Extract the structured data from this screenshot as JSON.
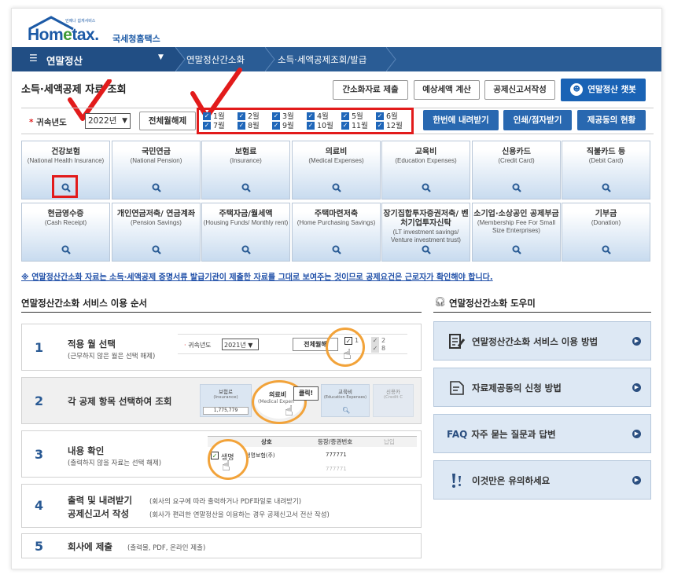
{
  "logo": {
    "tagline": "언제나 쉽게서비스",
    "brand_main": "Hom",
    "brand_e": "e",
    "brand_end": "tax.",
    "brand_kr": "국세청홈택스"
  },
  "nav": {
    "menu_label": "연말정산",
    "crumb1": "연말정산간소화",
    "crumb2": "소득·세액공제조회/발급"
  },
  "page": {
    "title": "소득·세액공제 자료 조회"
  },
  "top_buttons": [
    "간소화자료 제출",
    "예상세액 계산",
    "공제신고서작성",
    "연말정산 챗봇"
  ],
  "filter": {
    "label": "귀속년도",
    "year": "2022년",
    "deselect_all": "전체월해제",
    "months": [
      "1월",
      "2월",
      "3월",
      "4월",
      "5월",
      "6월",
      "7월",
      "8월",
      "9월",
      "10월",
      "11월",
      "12월"
    ],
    "actions": [
      "한번에 내려받기",
      "인쇄/점자받기",
      "제공동의 현황"
    ]
  },
  "tiles_row1": [
    {
      "ko": "건강보험",
      "en": "(National Health Insurance)"
    },
    {
      "ko": "국민연금",
      "en": "(National Pension)"
    },
    {
      "ko": "보험료",
      "en": "(Insurance)"
    },
    {
      "ko": "의료비",
      "en": "(Medical Expenses)"
    },
    {
      "ko": "교육비",
      "en": "(Education Expenses)"
    },
    {
      "ko": "신용카드",
      "en": "(Credit Card)"
    },
    {
      "ko": "직불카드 등",
      "en": "(Debit Card)"
    }
  ],
  "tiles_row2": [
    {
      "ko": "현금영수증",
      "en": "(Cash Receipt)"
    },
    {
      "ko": "개인연금저축/ 연금계좌",
      "en": "(Pension Savings)"
    },
    {
      "ko": "주택자금/월세액",
      "en": "(Housing Funds/ Monthly rent)"
    },
    {
      "ko": "주택마련저축",
      "en": "(Home Purchasing Savings)"
    },
    {
      "ko": "장기집합투자증권저축/ 벤처기업투자신탁",
      "en": "(LT investment savings/ Venture investment trust)"
    },
    {
      "ko": "소기업·소상공인 공제부금",
      "en": "(Membership Fee For Small Size Enterprises)"
    },
    {
      "ko": "기부금",
      "en": "(Donation)"
    }
  ],
  "notice": "※ 연말정산간소화 자료는 소득·세액공제 증명서류 발급기관이 제출한 자료를 그대로 보여주는 것이므로 공제요건은 근로자가 확인해야 합니다.",
  "steps_heading": "연말정산간소화 서비스 이용 순서",
  "steps": [
    {
      "num": "1",
      "title": "적용 월 선택",
      "desc": "(근무하지 않은 월은 선택 해제)"
    },
    {
      "num": "2",
      "title": "각 공제 항목 선택하여 조회",
      "desc": ""
    },
    {
      "num": "3",
      "title": "내용 확인",
      "desc": "(출력하지 않을 자료는 선택 해제)"
    },
    {
      "num": "4",
      "title": "출력 및 내려받기",
      "desc": "(회사의 요구에 따라 출력하거나 PDF파일로 내려받기)",
      "title2": "공제신고서 작성",
      "desc2": "(회사가 편리한 연말정산을 이용하는 경우 공제신고서 전산 작성)"
    },
    {
      "num": "5",
      "title": "회사에 제출",
      "desc": "(출력물, PDF, 온라인 제출)"
    }
  ],
  "step_illustrations": {
    "s1_label": "귀속년도",
    "s1_year": "2021년",
    "s1_btn": "전체월해",
    "s1_m1": "1",
    "s1_m2": "2",
    "s1_m8": "8",
    "s2_tile1": "보험료",
    "s2_tile1_en": "(Insurance)",
    "s2_amount": "1,775,779",
    "s2_tile2": "의료비",
    "s2_tile2_en": "(Medical Expen",
    "s2_tile3": "교육비",
    "s2_tile3_en": "(Education Expenses)",
    "s2_tile4": "신용카",
    "s2_tile4_en": "(Credit C",
    "s2_click": "클릭!",
    "s3_col1": "상호",
    "s3_col2": "등장/증권번호",
    "s3_col3": "납입",
    "s3_row1": "생명보험(주)",
    "s3_row1_id": "777771",
    "s3_row2_id": "777771",
    "s3_check": "생명"
  },
  "helper_heading": "연말정산간소화 도우미",
  "helpers": [
    {
      "icon": "document-edit-icon",
      "label": "연말정산간소화 서비스 이용 방법"
    },
    {
      "icon": "document-icon",
      "label": "자료제공동의 신청 방법"
    },
    {
      "icon": "faq-icon",
      "label": "자주 묻는 질문과 답변",
      "prefix": "FAQ"
    },
    {
      "icon": "warning-icon",
      "label": "이것만은 유의하세요"
    }
  ],
  "colors": {
    "nav": "#2a5c95",
    "accent_blue": "#1a63b5",
    "annotation_red": "#e21b1b",
    "ring": "#f2a33a"
  }
}
